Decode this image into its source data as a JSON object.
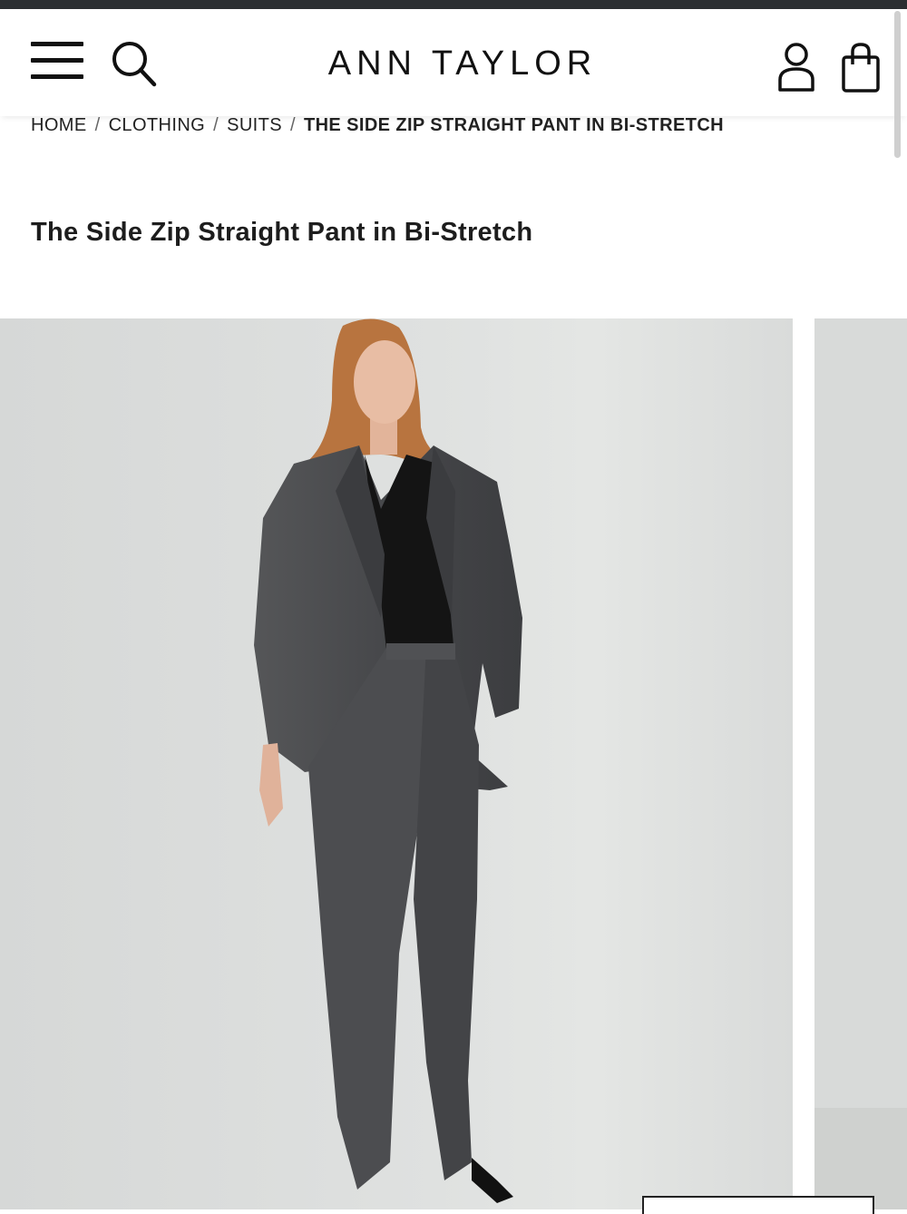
{
  "header": {
    "logo": "ANN TAYLOR",
    "menu_icon": "hamburger-menu-icon",
    "search_icon": "search-icon",
    "account_icon": "user-account-icon",
    "bag_icon": "shopping-bag-icon"
  },
  "breadcrumb": {
    "items": [
      "HOME",
      "CLOTHING",
      "SUITS"
    ],
    "separator": "/",
    "current": "THE SIDE ZIP STRAIGHT PANT IN BI-STRETCH"
  },
  "product": {
    "title": "The Side Zip Straight Pant in Bi-Stretch"
  },
  "colors": {
    "status_strip": "#2b2e31",
    "text": "#1a1a1a",
    "image_bg": "#d8dad8",
    "suit_grey": "#4a4b4d",
    "shirt_black": "#121212",
    "hair": "#b8743f",
    "skin": "#e6b9a0"
  }
}
